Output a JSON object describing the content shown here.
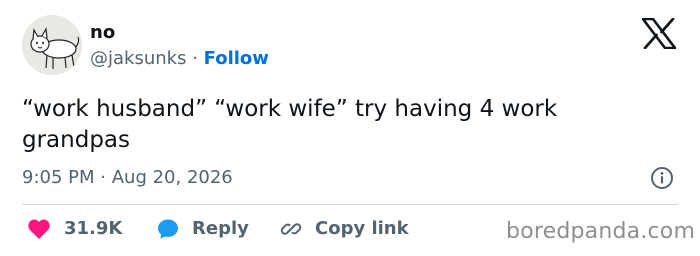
{
  "author": {
    "display_name": "no",
    "handle": "@jaksunks",
    "separator": "·",
    "follow_label": "Follow"
  },
  "tweet": {
    "text_line_1": "“work husband” “work wife” try having 4 work",
    "text_line_2": "grandpas",
    "time": "9:05 PM",
    "separator": "·",
    "date": "Aug 20, 2026"
  },
  "actions": {
    "likes_count": "31.9K",
    "reply_label": "Reply",
    "copy_link_label": "Copy link"
  },
  "watermark": "boredpanda.com",
  "icons": {
    "brand": "x-logo-icon",
    "info": "info-icon",
    "like": "heart-icon",
    "reply": "speech-bubble-icon",
    "copy": "link-icon"
  },
  "colors": {
    "text": "#0f1419",
    "secondary_text": "#536471",
    "follow_blue": "#006fd6",
    "like_red": "#f91880",
    "reply_blue": "#1d9bf0",
    "divider": "#cfd9de"
  }
}
